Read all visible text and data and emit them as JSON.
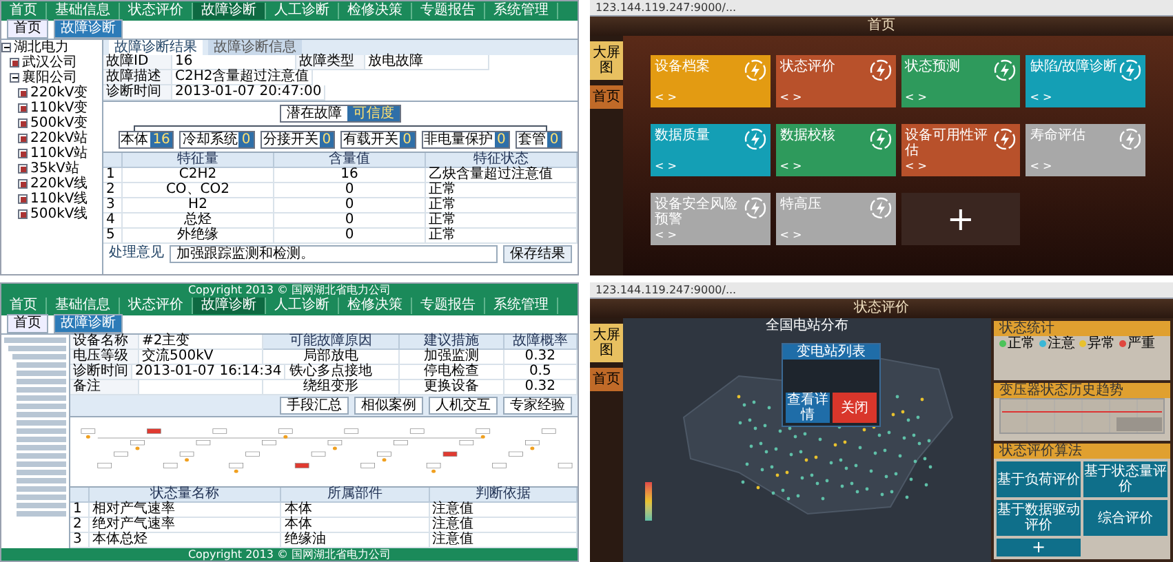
{
  "fault_window": {
    "menu": [
      {
        "label": "首页",
        "selected": false
      },
      {
        "label": "基础信息",
        "selected": false
      },
      {
        "label": "状态评价",
        "selected": false
      },
      {
        "label": "故障诊断",
        "selected": true
      },
      {
        "label": "人工诊断",
        "selected": false
      },
      {
        "label": "检修决策",
        "selected": false
      },
      {
        "label": "专题报告",
        "selected": false
      },
      {
        "label": "系统管理",
        "selected": false
      }
    ],
    "tabs": [
      {
        "label": "首页",
        "selected": false
      },
      {
        "label": "故障诊断",
        "selected": true
      }
    ],
    "tree": [
      {
        "label": "湖北电力",
        "expanded": true,
        "children": [
          {
            "label": "武汉公司",
            "expanded": false
          },
          {
            "label": "襄阳公司",
            "expanded": true,
            "children": [
              {
                "label": "220kV变",
                "expanded": false
              },
              {
                "label": "110kV变",
                "expanded": false
              },
              {
                "label": "500kV变",
                "expanded": false
              },
              {
                "label": "220kV站",
                "expanded": false
              },
              {
                "label": "110kV站",
                "expanded": false
              },
              {
                "label": "35kV站",
                "expanded": false
              },
              {
                "label": "220kV线",
                "expanded": false
              },
              {
                "label": "110kV线",
                "expanded": false
              },
              {
                "label": "500kV线",
                "expanded": false
              }
            ]
          }
        ]
      }
    ],
    "subtabs": [
      {
        "label": "故障诊断结果",
        "selected": true
      },
      {
        "label": "故障诊断信息",
        "selected": false
      }
    ],
    "info": [
      [
        {
          "label": "故障ID",
          "value": "16"
        },
        {
          "label": "故障类型",
          "value": "放电故障"
        }
      ],
      [
        {
          "label": "故障描述",
          "value": "C2H2含量超过注意值"
        }
      ],
      [
        {
          "label": "诊断时间",
          "value": "2013-01-07 20:47:00"
        }
      ]
    ],
    "root": {
      "label": "潜在故障",
      "badge": "可信度"
    },
    "nodes": [
      {
        "label": "本体",
        "badge": "16"
      },
      {
        "label": "冷却系统",
        "badge": "0"
      },
      {
        "label": "分接开关",
        "badge": "0"
      },
      {
        "label": "有载开关",
        "badge": "0"
      },
      {
        "label": "非电量保护",
        "badge": "0"
      },
      {
        "label": "套管",
        "badge": "0"
      }
    ],
    "columns": [
      "特征量",
      "含量值",
      "特征状态"
    ],
    "rows": [
      {
        "no": "1",
        "cells": [
          "C2H2",
          "16",
          "乙炔含量超过注意值"
        ]
      },
      {
        "no": "2",
        "cells": [
          "CO、CO2",
          "0",
          "正常"
        ]
      },
      {
        "no": "3",
        "cells": [
          "H2",
          "0",
          "正常"
        ]
      },
      {
        "no": "4",
        "cells": [
          "总烃",
          "0",
          "正常"
        ]
      },
      {
        "no": "5",
        "cells": [
          "外绝缘",
          "0",
          "正常"
        ]
      }
    ],
    "comment_label": "处理意见",
    "comment": "加强跟踪监测和检测。",
    "save": "保存结果"
  },
  "home_dashboard": {
    "url": "123.144.119.247:9000/...",
    "title": "首页",
    "side": [
      {
        "label": "大屏图",
        "selected": true
      },
      {
        "label": "首页",
        "selected": false
      }
    ],
    "tiles": [
      {
        "label": "设备档案",
        "color": "#e39b12"
      },
      {
        "label": "状态评价",
        "color": "#b8512b"
      },
      {
        "label": "状态预测",
        "color": "#2e9a5c"
      },
      {
        "label": "缺陷/故障诊断",
        "color": "#149fb5"
      },
      {
        "label": "数据质量",
        "color": "#149fb5"
      },
      {
        "label": "数据校核",
        "color": "#2e9a5c"
      },
      {
        "label": "设备可用性评估",
        "color": "#b8512b"
      },
      {
        "label": "寿命评估",
        "color": "#a8a8a8"
      },
      {
        "label": "设备安全风险预警",
        "color": "#a8a8a8"
      },
      {
        "label": "特高压",
        "color": "#a8a8a8"
      }
    ],
    "nav": "< >",
    "add": "+"
  },
  "diagnosis_window": {
    "copyright_top": "Copyright 2013 © 国网湖北省电力公司",
    "menu": [
      {
        "label": "首页",
        "selected": false
      },
      {
        "label": "基础信息",
        "selected": false
      },
      {
        "label": "状态评价",
        "selected": false
      },
      {
        "label": "故障诊断",
        "selected": true
      },
      {
        "label": "人工诊断",
        "selected": false
      },
      {
        "label": "检修决策",
        "selected": false
      },
      {
        "label": "专题报告",
        "selected": false
      },
      {
        "label": "系统管理",
        "selected": false
      }
    ],
    "tabs": [
      {
        "label": "首页",
        "selected": false
      },
      {
        "label": "故障诊断",
        "selected": true
      }
    ],
    "form": [
      {
        "label": "设备名称",
        "value": "#2主变"
      },
      {
        "label": "电压等级",
        "value": "交流500kV"
      },
      {
        "label": "诊断时间",
        "value": "2013-01-07 16:14:34"
      },
      {
        "label": "备注"
      }
    ],
    "fault_columns": [
      "可能故障原因",
      "建议措施",
      "故障概率"
    ],
    "fault_rows": [
      [
        "局部放电",
        "加强监测",
        "0.32"
      ],
      [
        "铁心多点接地",
        "停电检查",
        "0.5"
      ],
      [
        "绕组变形",
        "更换设备",
        "0.32"
      ]
    ],
    "actions": [
      "手段汇总",
      "相似案例",
      "人机交互",
      "专家经验"
    ],
    "columns": [
      "状态量名称",
      "所属部件",
      "判断依据"
    ],
    "rows": [
      {
        "no": "1",
        "cells": [
          "相对产气速率",
          "本体",
          "注意值"
        ]
      },
      {
        "no": "2",
        "cells": [
          "绝对产气速率",
          "本体",
          "注意值"
        ]
      },
      {
        "no": "3",
        "cells": [
          "本体总烃",
          "绝缘油",
          "注意值"
        ]
      }
    ],
    "footer": "Copyright 2013 © 国网湖北省电力公司"
  },
  "status_dashboard": {
    "url": "123.144.119.247:9000/...",
    "title": "状态评价",
    "side": [
      {
        "label": "大屏图",
        "selected": true
      },
      {
        "label": "首页",
        "selected": false
      }
    ],
    "map_title": "全国电站分布",
    "popup_title": "变电站列表",
    "popup_buttons": [
      "查看详情",
      "关闭"
    ],
    "stats_title": "状态统计",
    "legend": [
      {
        "label": "正常",
        "color": "#4cc35a"
      },
      {
        "label": "注意",
        "color": "#3ab7d6"
      },
      {
        "label": "异常",
        "color": "#e8c22e"
      },
      {
        "label": "严重",
        "color": "#e0463e"
      }
    ],
    "trend_title": "变压器状态历史趋势",
    "algo_title": "状态评价算法",
    "algos": [
      "基于负荷评价",
      "基于状态量评价",
      "基于数据驱动评价",
      "综合评价"
    ],
    "add": "+"
  }
}
